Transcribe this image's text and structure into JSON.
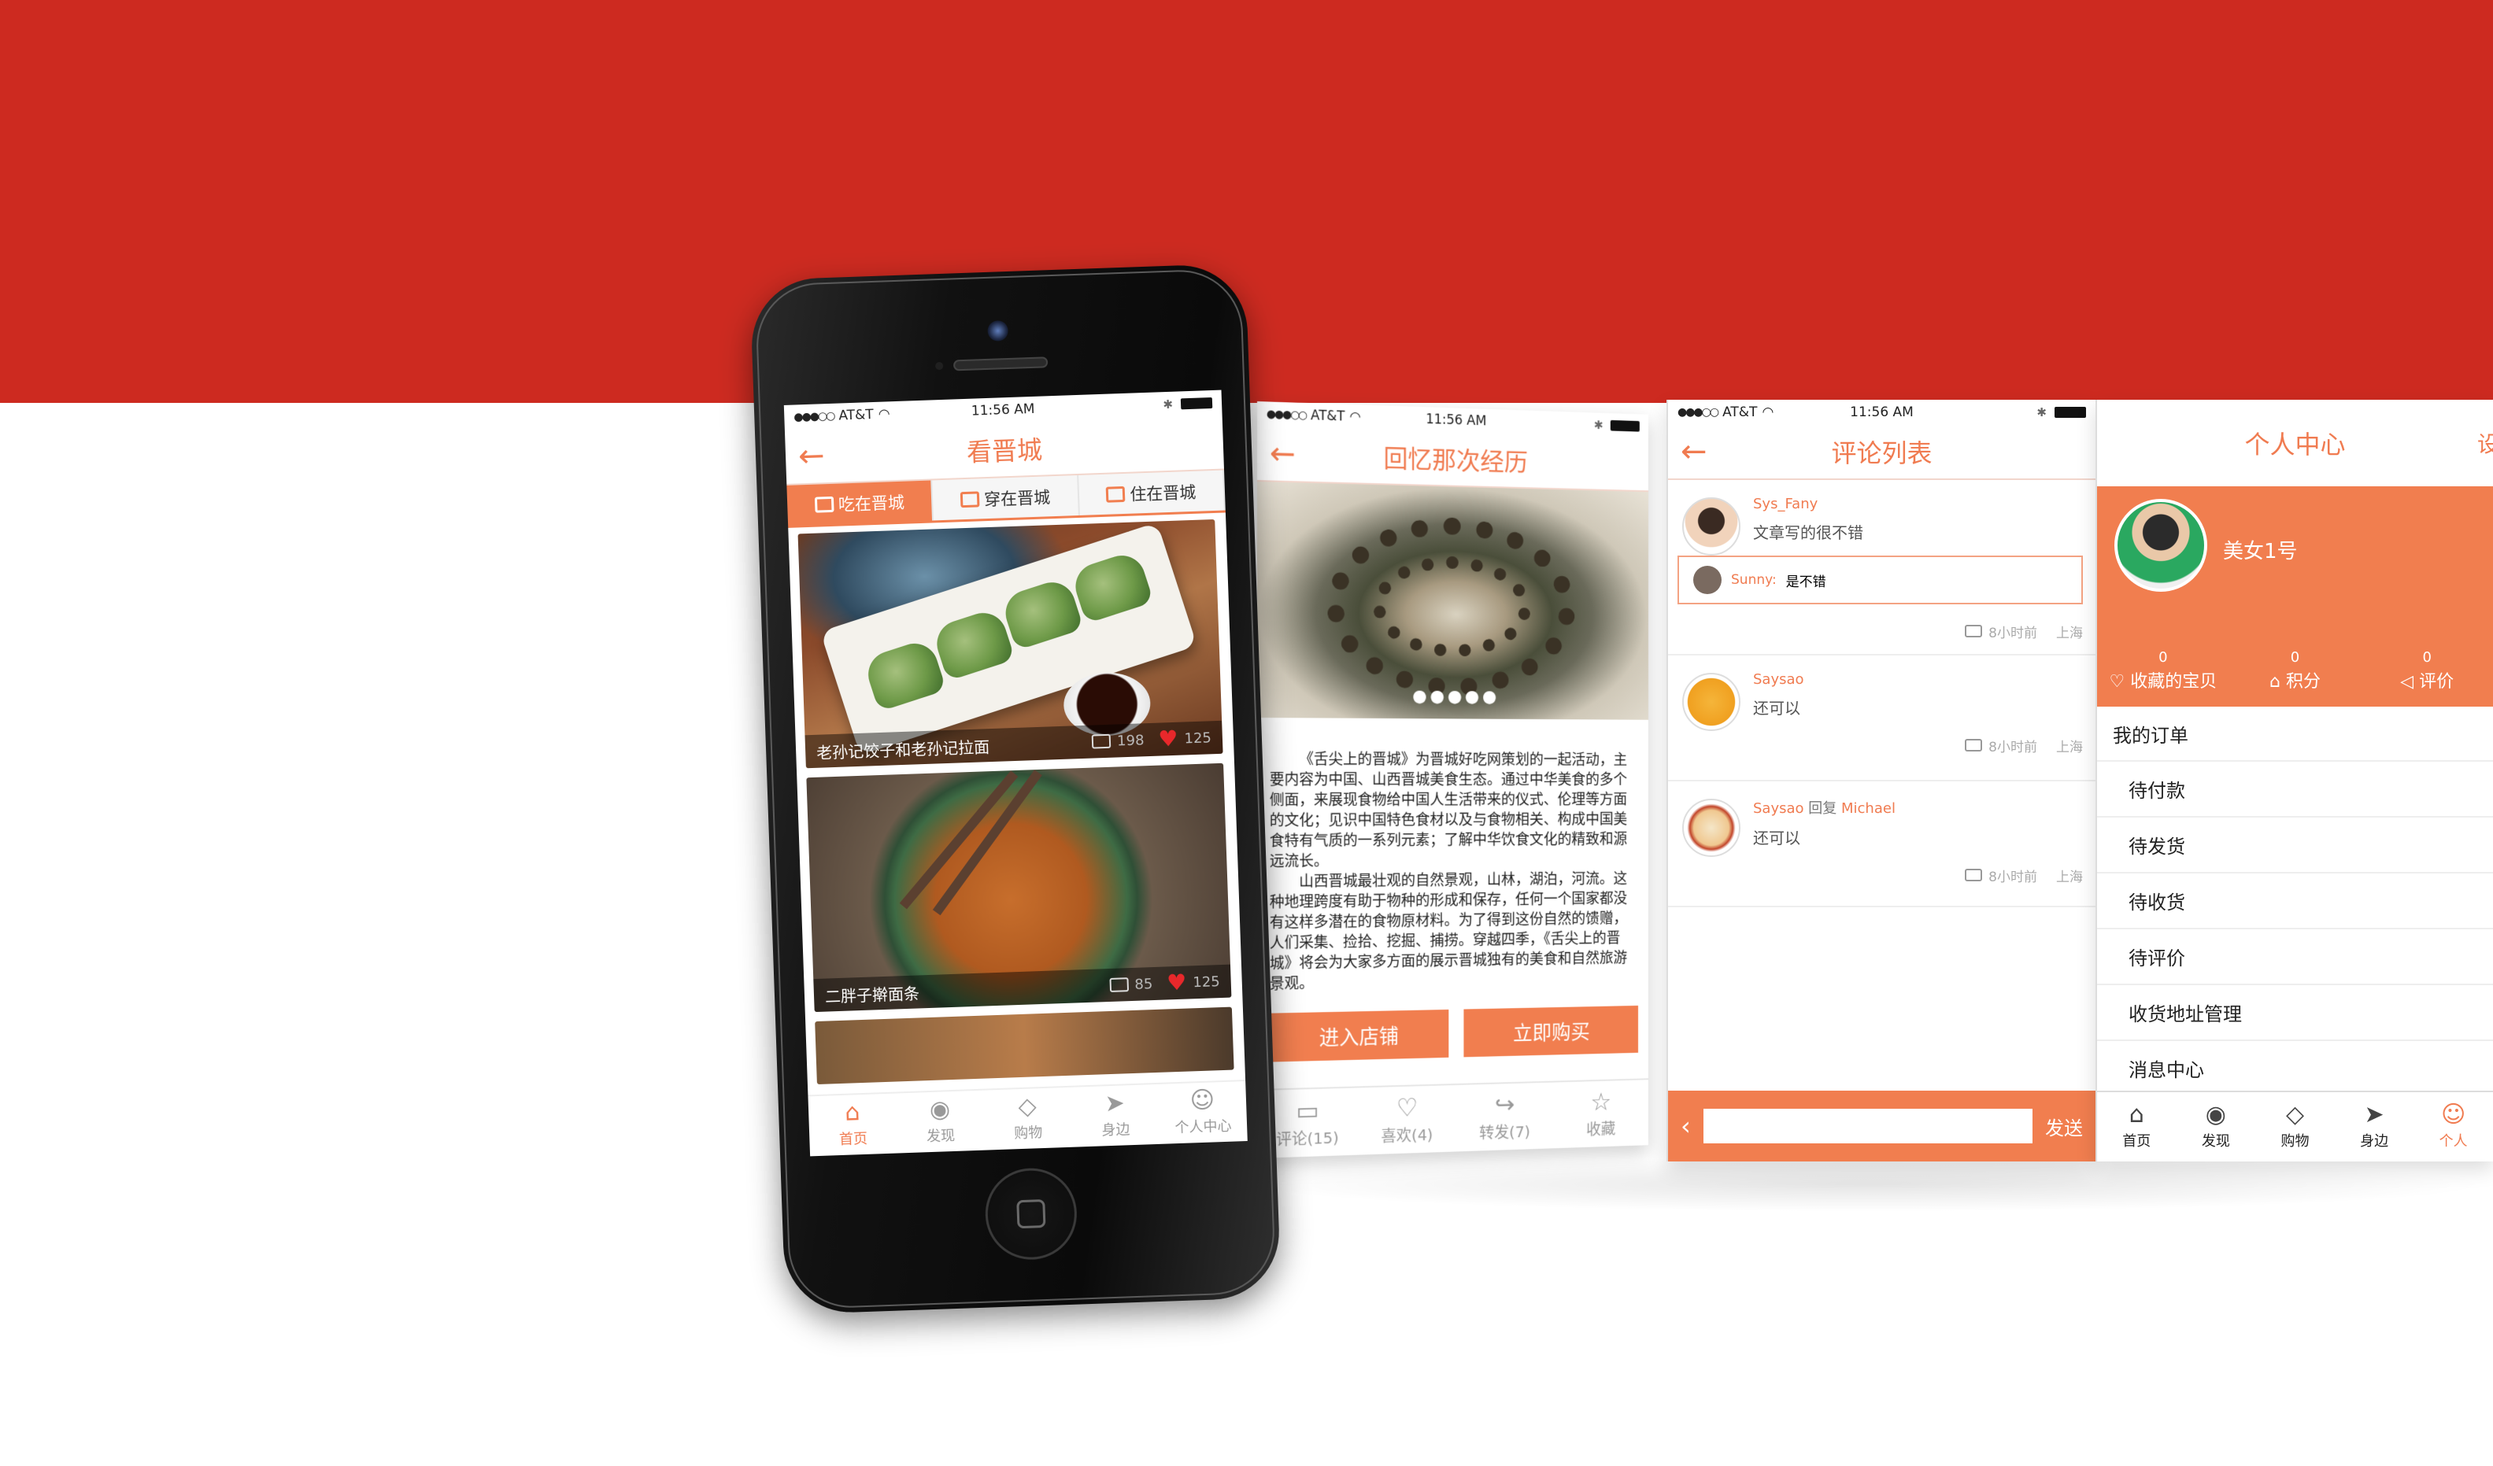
{
  "status": {
    "carrier": "AT&T",
    "time": "11:56 AM"
  },
  "screen1": {
    "title": "看晋城",
    "tabs": [
      "吃在晋城",
      "穿在晋城",
      "住在晋城"
    ],
    "cards": [
      {
        "caption": "老孙记饺子和老孙记拉面",
        "comments": "198",
        "likes": "125"
      },
      {
        "caption": "二胖子擀面条",
        "comments": "85",
        "likes": "125"
      }
    ],
    "tabbar": [
      "首页",
      "发现",
      "购物",
      "身边",
      "个人中心"
    ]
  },
  "screen2": {
    "title": "回忆那次经历",
    "slider_dots": "●●●●●",
    "paragraphs": [
      "《舌尖上的晋城》为晋城好吃网策划的一起活动，主要内容为中国、山西晋城美食生态。通过中华美食的多个侧面，来展现食物给中国人生活带来的仪式、伦理等方面的文化；见识中国特色食材以及与食物相关、构成中国美食特有气质的一系列元素；了解中华饮食文化的精致和源远流长。",
      "山西晋城最壮观的自然景观，山林，湖泊，河流。这种地理跨度有助于物种的形成和保存，任何一个国家都没有这样多潜在的食物原材料。为了得到这份自然的馈赠，人们采集、捡拾、挖掘、捕捞。穿越四季，《舌尖上的晋城》将会为大家多方面的展示晋城独有的美食和自然旅游景观。"
    ],
    "buttons": [
      "进入店铺",
      "立即购买"
    ],
    "actions": [
      "评论(15)",
      "喜欢(4)",
      "转发(7)",
      "收藏"
    ]
  },
  "screen3": {
    "title": "评论列表",
    "comments": [
      {
        "user": "Sys_Fany",
        "text": "文章写的很不错",
        "reply_user": "Sunny:",
        "reply_text": "是不错",
        "time": "8小时前",
        "place": "上海"
      },
      {
        "user": "Saysao",
        "text": "还可以",
        "time": "8小时前",
        "place": "上海"
      },
      {
        "user": "Saysao",
        "reply_word": "回复",
        "reply_to": "Michael",
        "text": "还可以",
        "time": "8小时前",
        "place": "上海"
      }
    ],
    "send_label": "发送"
  },
  "screen4": {
    "title": "个人中心",
    "title_right": "设",
    "username": "美女1号",
    "stats": [
      {
        "num": "0",
        "label": "收藏的宝贝"
      },
      {
        "num": "0",
        "label": "积分"
      },
      {
        "num": "0",
        "label": "评价"
      }
    ],
    "menu_title": "我的订单",
    "menu": [
      "待付款",
      "待发货",
      "待收货",
      "待评价",
      "收货地址管理",
      "消息中心"
    ],
    "tabbar": [
      "首页",
      "发现",
      "购物",
      "身边",
      "个人"
    ]
  },
  "colors": {
    "brand": "#f17e4f",
    "band": "#cd2a20",
    "heart": "#e8282b"
  }
}
